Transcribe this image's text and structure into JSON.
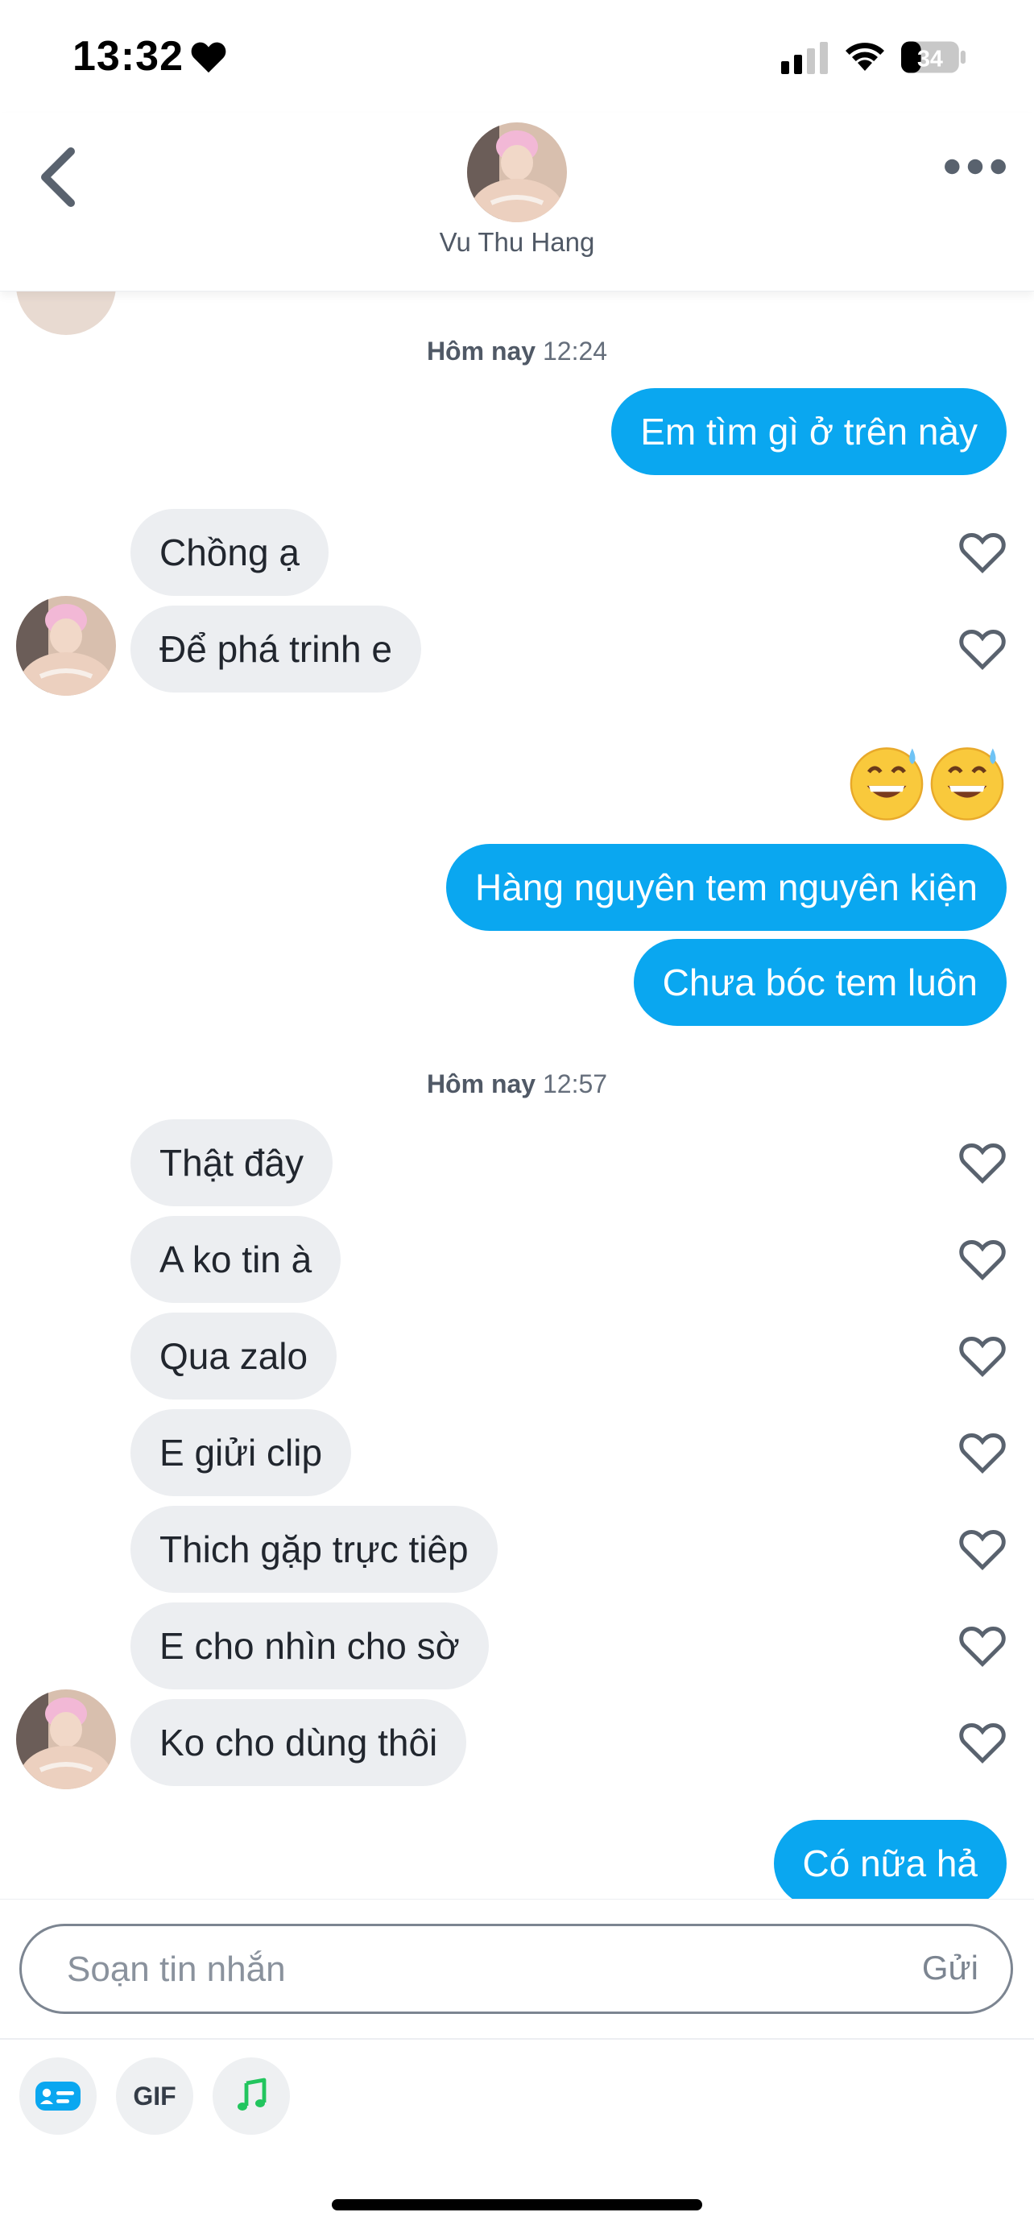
{
  "status_bar": {
    "time": "13:32",
    "battery": "34"
  },
  "header": {
    "contact_name": "Vu Thu Hang"
  },
  "colors": {
    "outgoing_bubble": "#0aa7f0",
    "incoming_bubble": "#eceef1",
    "text": "#21262e"
  },
  "chat": {
    "timestamps": [
      {
        "label": "Hôm nay",
        "time": "12:24"
      },
      {
        "label": "Hôm nay",
        "time": "12:57"
      }
    ],
    "messages": [
      {
        "dir": "out",
        "text": "Em tìm gì ở trên này"
      },
      {
        "dir": "in",
        "text": "Chồng ạ"
      },
      {
        "dir": "in",
        "text": "Để phá trinh e"
      },
      {
        "dir": "out",
        "emoji": "grinning-sweat-face",
        "count": 2
      },
      {
        "dir": "out",
        "text": "Hàng nguyên tem nguyên kiện"
      },
      {
        "dir": "out",
        "text": "Chưa bóc tem luôn"
      },
      {
        "dir": "in",
        "text": "Thật đây"
      },
      {
        "dir": "in",
        "text": "A ko tin à"
      },
      {
        "dir": "in",
        "text": "Qua zalo"
      },
      {
        "dir": "in",
        "text": "E giửi clip"
      },
      {
        "dir": "in",
        "text": "Thich gặp trực tiêp"
      },
      {
        "dir": "in",
        "text": "E cho nhìn cho sờ"
      },
      {
        "dir": "in",
        "text": "Ko cho dùng thôi"
      },
      {
        "dir": "out",
        "text": "Có nữa hả"
      }
    ]
  },
  "composer": {
    "placeholder": "Soạn tin nhắn",
    "value": "",
    "send_label": "Gửi",
    "tools": [
      {
        "icon": "id-card-icon"
      },
      {
        "label": "GIF"
      },
      {
        "icon": "music-note-icon"
      }
    ]
  }
}
